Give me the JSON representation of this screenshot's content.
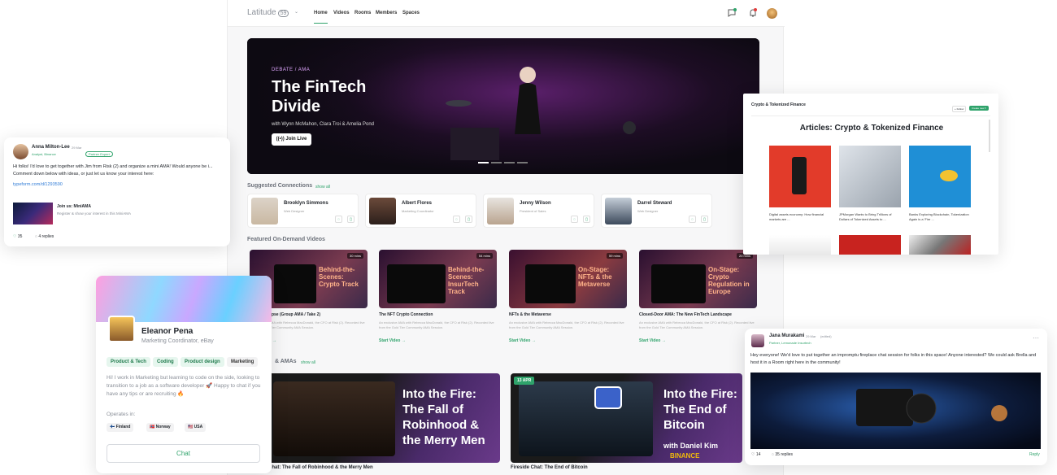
{
  "app": {
    "logo": "Latitude",
    "logo_badge": "59",
    "nav": [
      "Home",
      "Videos",
      "Rooms",
      "Members",
      "Spaces"
    ]
  },
  "hero": {
    "tag": "DEBATE / AMA",
    "title": "The FinTech Divide",
    "subtitle": "with Wynn McMahon, Clara Troi & Amelia Pond",
    "button": "Join Live"
  },
  "connections": {
    "title": "Suggested Connections",
    "show_all": "show all",
    "items": [
      {
        "name": "Brooklyn Simmons",
        "role": "Web Designer"
      },
      {
        "name": "Albert Flores",
        "role": "Marketing Coordinator"
      },
      {
        "name": "Jenny Wilson",
        "role": "President of Sales"
      },
      {
        "name": "Darrel Steward",
        "role": "Web Designer"
      }
    ]
  },
  "videos": {
    "title": "Featured On-Demand Videos",
    "items": [
      {
        "duration": "30 mins",
        "thumb_title": "Behind-the-Scenes: Crypto Track",
        "title": "NFT-pocalypse (Group AMA / Take 2)",
        "desc": "An exclusive AMA with Rebecca MacDonald, the CFO at Risk (2). Recorded live from the Gold Tier Community AMA Session.",
        "cta": "Start Video →"
      },
      {
        "duration": "54 mins",
        "thumb_title": "Behind-the-Scenes: InsurTech Track",
        "title": "The NFT Crypto Connection",
        "desc": "An exclusive AMA with Rebecca MacDonald, the CFO at Risk (2). Recorded live from the Gold Tier Community AMA Session.",
        "cta": "Start Video →"
      },
      {
        "duration": "59 mins",
        "thumb_title": "On-Stage: NFTs & the Metaverse",
        "title": "NFTs & the Metaverse",
        "desc": "An exclusive AMA with Rebecca MacDonald, the CFO at Risk (2). Recorded live from the Gold Tier Community AMA Session.",
        "cta": "Start Video →"
      },
      {
        "duration": "20 mins",
        "thumb_title": "On-Stage: Crypto Regulation in Europe",
        "title": "Closed-Door AMA: The New FinTech Landscape",
        "desc": "An exclusive AMA with Rebecca MacDonald, the CFO at Risk (2). Recorded live from the Gold Tier Community AMA Session.",
        "cta": "Start Video →"
      }
    ]
  },
  "amas": {
    "title": "& AMAs",
    "show_all": "show all",
    "items": [
      {
        "thumb_title": "Into the Fire: The Fall of Robinhood & the Merry Men",
        "caption": "Chat: The Fall of Robinhood & the Merry Men"
      },
      {
        "date": "13 APR",
        "thumb_title": "Into the Fire: The End of Bitcoin",
        "sub": "with Daniel Kim",
        "sponsor": "BINANCE",
        "caption": "Fireside Chat: The End of Bitcoin"
      }
    ]
  },
  "post1": {
    "author": "Anna Milton-Lee",
    "date": "29 Mar",
    "badge": "Partner Expert",
    "role": "Analyst, Binance",
    "body": "Hi folks! I'd love to get together with Jim from Risk (2) and organize a mini AMA! Would anyone be i... Comment down below with ideas, or just let us know your interest here:",
    "link": "typeform.com/d/1293590",
    "attach_title": "Join us: MiniAMA",
    "attach_sub": "Register & show your interest in this MiniAMA",
    "likes": "35",
    "replies": "4 replies"
  },
  "profile": {
    "name": "Eleanor Pena",
    "role": "Marketing Coordinator, eBay",
    "tags": [
      "Product & Tech",
      "Coding",
      "Product design",
      "Marketing"
    ],
    "bio": "Hi! I work in Marketing but learning to code on the side, looking to transition to a job as a software developer 🚀 Happy to chat if you have any tips or are recruiting 🔥",
    "operates_label": "Operates in:",
    "countries": [
      "Finland",
      "Norway",
      "USA"
    ],
    "chat": "Chat"
  },
  "articles": {
    "crumb": "Crypto & Tokenized Finance",
    "follow": "+ Follow",
    "create": "Create new ▾",
    "heading": "Articles: Crypto & Tokenized Finance",
    "items": [
      {
        "caption": "Digital assets economy: How financial markets are ..."
      },
      {
        "caption": "JPMorgan Wants to Bring Trillions of Dollars of Tokenized Assets to ..."
      },
      {
        "caption": "Banks Exploring Blockchain, Tokenization Again is a 'Fire ..."
      }
    ]
  },
  "post2": {
    "author": "Jana Murakami",
    "date": "29 Mar",
    "edited": "(edited)",
    "role": "Partner, Lemonade Insurtech",
    "body": "Hey everyone! We'd love to put together an impromptu fireplace chat session for folks in this space! Anyone interested? We could ask Brella and host it in a Room right here in the community!",
    "likes": "14",
    "replies": "35 replies",
    "reply": "Reply"
  }
}
